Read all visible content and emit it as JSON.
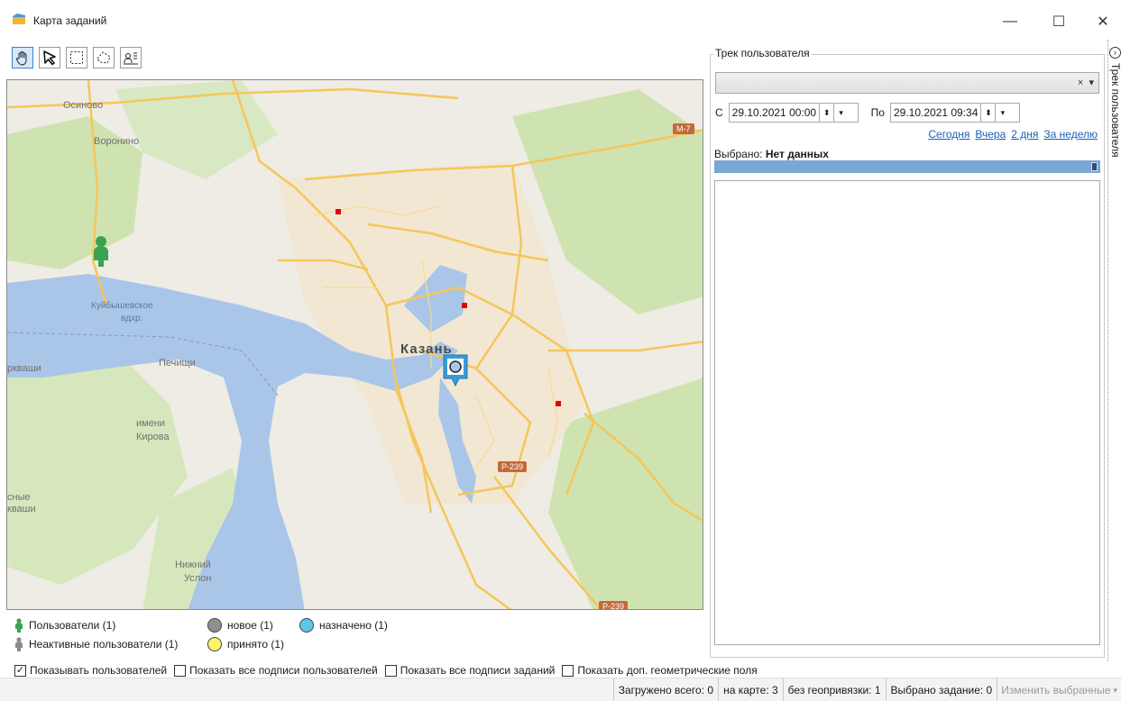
{
  "window": {
    "title": "Карта заданий",
    "minimize": "—",
    "maximize": "☐",
    "close": "✕"
  },
  "toolbar": {
    "tools": [
      "hand-icon",
      "arrow-select-icon",
      "rect-select-icon",
      "polygon-select-icon",
      "user-pin-icon"
    ]
  },
  "map": {
    "labels": {
      "osinovo": "Осиново",
      "voronino": "Воронино",
      "kuybyshev": "Куйбышевское",
      "vdkhr": "вдхр.",
      "kazan": "Казань",
      "pechishchi": "Печищи",
      "imeni": "имени",
      "kirova": "Кирова",
      "rkvashi": "ркваши",
      "sny": "сные",
      "kvashi": "кваши",
      "nizhny": "Нижний",
      "uslon": "Услон"
    },
    "shields": {
      "m7": "М-7",
      "p239": "Р-239",
      "p239b": "Р-239"
    },
    "colors": {
      "water": "#a9c6e8",
      "land": "#eeece4",
      "forest": "#cfe3b0",
      "road": "#f5c65a",
      "pin": "#3b9bd9"
    }
  },
  "legend": {
    "users": "Пользователи (1)",
    "inactive_users": "Неактивные пользователи (1)",
    "new": "новое (1)",
    "accepted": "принято (1)",
    "assigned": "назначено (1)"
  },
  "checkboxes": {
    "show_users": "Показывать пользователей",
    "show_user_captions": "Показать все подписи пользователей",
    "show_task_captions": "Показать все подписи заданий",
    "show_geo_fields": "Показать доп. геометрические поля"
  },
  "status": {
    "loaded": "Загружено всего: 0",
    "on_map": "на карте: 3",
    "no_geo": "без геопривязки: 1",
    "selected_task": "Выбрано задание: 0",
    "change_selected": "Изменить выбранные"
  },
  "panel": {
    "group_title": "Трек пользователя",
    "clear": "×",
    "dropdown": "▾",
    "from_label": "С",
    "from_value": "29.10.2021 00:00",
    "to_label": "По",
    "to_value": "29.10.2021 09:34",
    "quick": {
      "today": "Сегодня",
      "yesterday": "Вчера",
      "two_days": "2 дня",
      "week": "За неделю"
    },
    "selected_label": "Выбрано: ",
    "selected_value": "Нет данных"
  },
  "sidetab": {
    "label": "Трек пользователя",
    "arrow": "›"
  }
}
